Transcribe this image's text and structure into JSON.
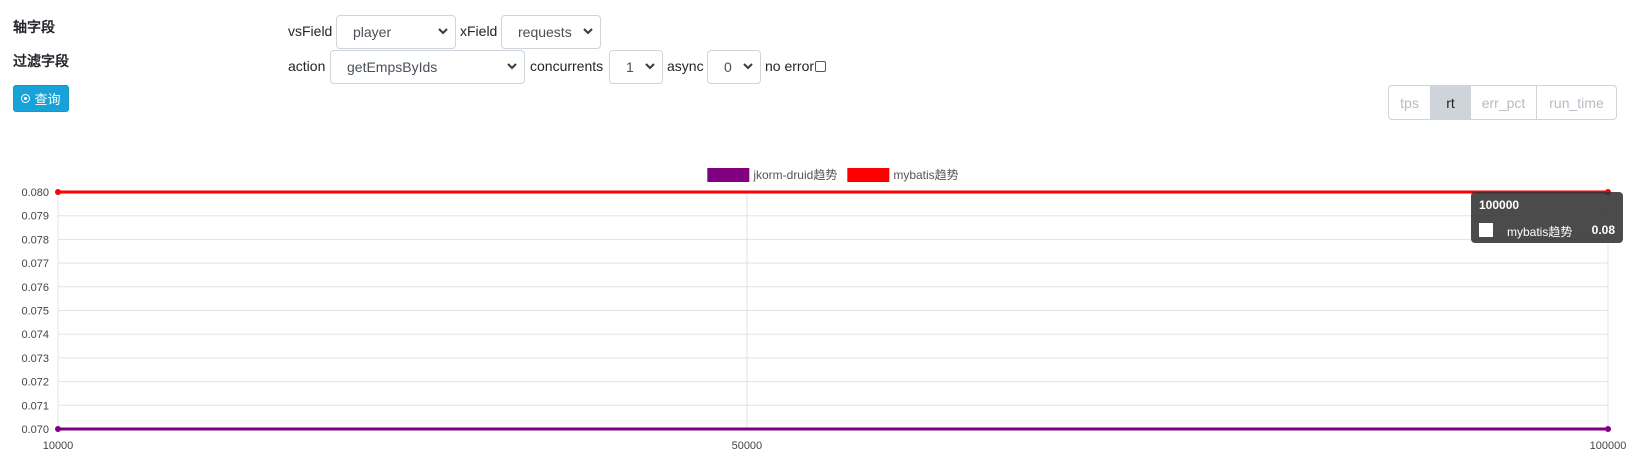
{
  "filters": {
    "axis_label": "轴字段",
    "filter_label": "过滤字段",
    "query_button": "查询",
    "vsField": {
      "label": "vsField",
      "value": "player"
    },
    "xField": {
      "label": "xField",
      "value": "requests"
    },
    "action": {
      "label": "action",
      "value": "getEmpsByIds"
    },
    "concurrents": {
      "label": "concurrents",
      "value": "1"
    },
    "async": {
      "label": "async",
      "value": "0"
    },
    "no_error": {
      "label": "no error",
      "checked": false
    }
  },
  "metric_tabs": [
    {
      "label": "tps",
      "active": false
    },
    {
      "label": "rt",
      "active": true
    },
    {
      "label": "err_pct",
      "active": false
    },
    {
      "label": "run_time",
      "active": false
    }
  ],
  "chart_data": {
    "type": "line",
    "x": [
      10000,
      100000
    ],
    "x_tick_labels": [
      "10000",
      "50000",
      "100000"
    ],
    "xlim": [
      10000,
      100000
    ],
    "ylim": [
      0.07,
      0.08
    ],
    "y_tick_labels": [
      "0.070",
      "0.071",
      "0.072",
      "0.073",
      "0.074",
      "0.075",
      "0.076",
      "0.077",
      "0.078",
      "0.079",
      "0.080"
    ],
    "series": [
      {
        "name": "jkorm-druid趋势",
        "color": "#800080",
        "values": [
          0.07,
          0.07
        ]
      },
      {
        "name": "mybatis趋势",
        "color": "#ff0000",
        "values": [
          0.08,
          0.08
        ]
      }
    ],
    "grid": true,
    "legend": "top-center",
    "tooltip": {
      "title": "100000",
      "series_name": "mybatis趋势",
      "value": "0.08"
    }
  }
}
